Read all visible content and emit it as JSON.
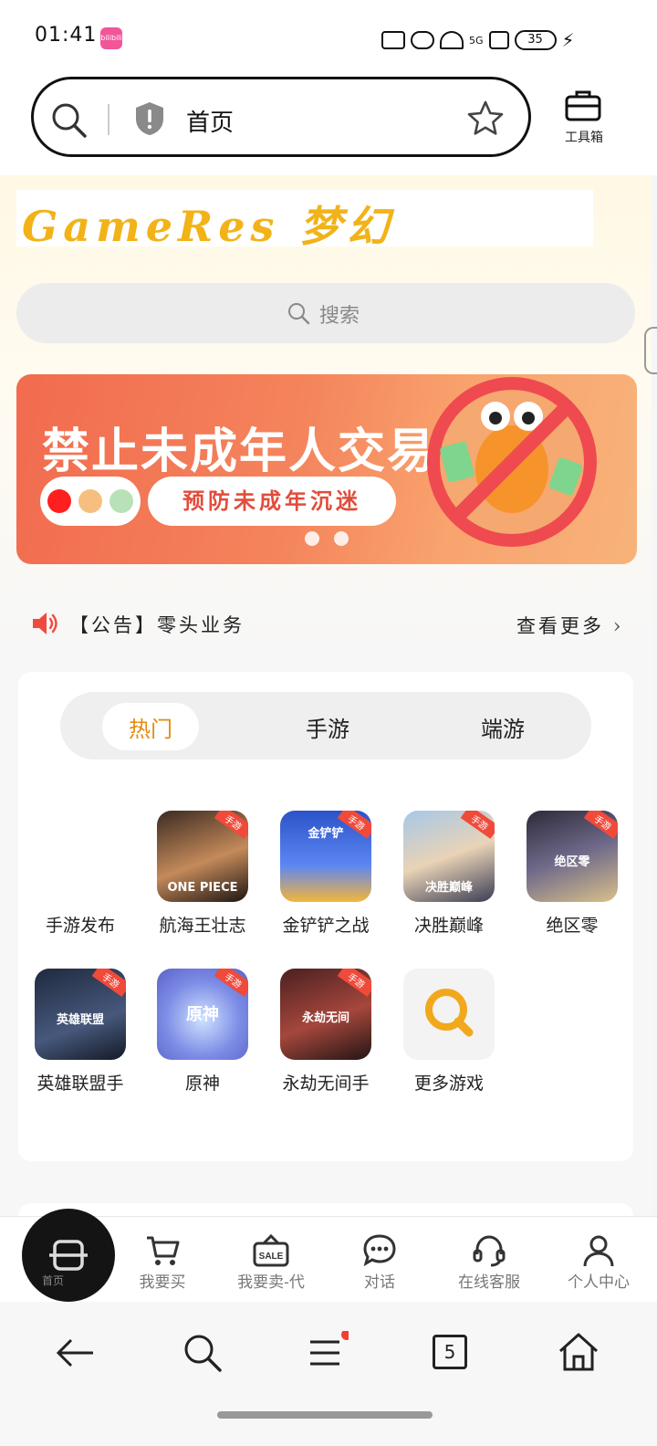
{
  "status_bar": {
    "time": "01:41",
    "app_badge": "bilibili",
    "signal_label": "5G",
    "battery": "35"
  },
  "browser": {
    "url_text": "首页",
    "toolbox_label": "工具箱"
  },
  "site": {
    "logo_text": "GameRes 梦幻",
    "search_placeholder": "搜索"
  },
  "banner": {
    "title": "禁止未成年人交易",
    "subtitle": "预防未成年沉迷",
    "dot_colors": [
      "#ff1f1f",
      "#f7bf7f",
      "#b9e1b7"
    ]
  },
  "notice": {
    "text": "【公告】零头业务",
    "more": "查看更多"
  },
  "tabs": [
    {
      "label": "热门",
      "active": true
    },
    {
      "label": "手游",
      "active": false
    },
    {
      "label": "端游",
      "active": false
    }
  ],
  "games": [
    {
      "label": "手游发布",
      "tile_name": "",
      "tag": ""
    },
    {
      "label": "航海王壮志",
      "tile_name": "ONE PIECE",
      "tag": "手游"
    },
    {
      "label": "金铲铲之战",
      "tile_name": "金铲铲",
      "tag": "手游"
    },
    {
      "label": "决胜巅峰",
      "tile_name": "决胜巅峰",
      "tag": "手游"
    },
    {
      "label": "绝区零",
      "tile_name": "绝区零",
      "tag": "手游"
    },
    {
      "label": "英雄联盟手",
      "tile_name": "英雄联盟",
      "tag": "手游"
    },
    {
      "label": "原神",
      "tile_name": "原神",
      "tag": "手游"
    },
    {
      "label": "永劫无间手",
      "tile_name": "永劫无间",
      "tag": "手游"
    },
    {
      "label": "更多游戏",
      "tile_name": "",
      "tag": ""
    }
  ],
  "app_nav": {
    "fab_label": "首页",
    "items": [
      {
        "label": "我要买",
        "icon": "cart-icon"
      },
      {
        "label": "我要卖-代",
        "icon": "sale-tag-icon"
      },
      {
        "label": "对话",
        "icon": "chat-icon"
      },
      {
        "label": "在线客服",
        "icon": "headset-icon"
      },
      {
        "label": "个人中心",
        "icon": "user-icon"
      }
    ]
  },
  "system_nav": {
    "tab_count": "5"
  },
  "colors": {
    "accent": "#e58a0f",
    "banner_red": "#f26b4f",
    "logo_yellow": "#f2b318"
  }
}
